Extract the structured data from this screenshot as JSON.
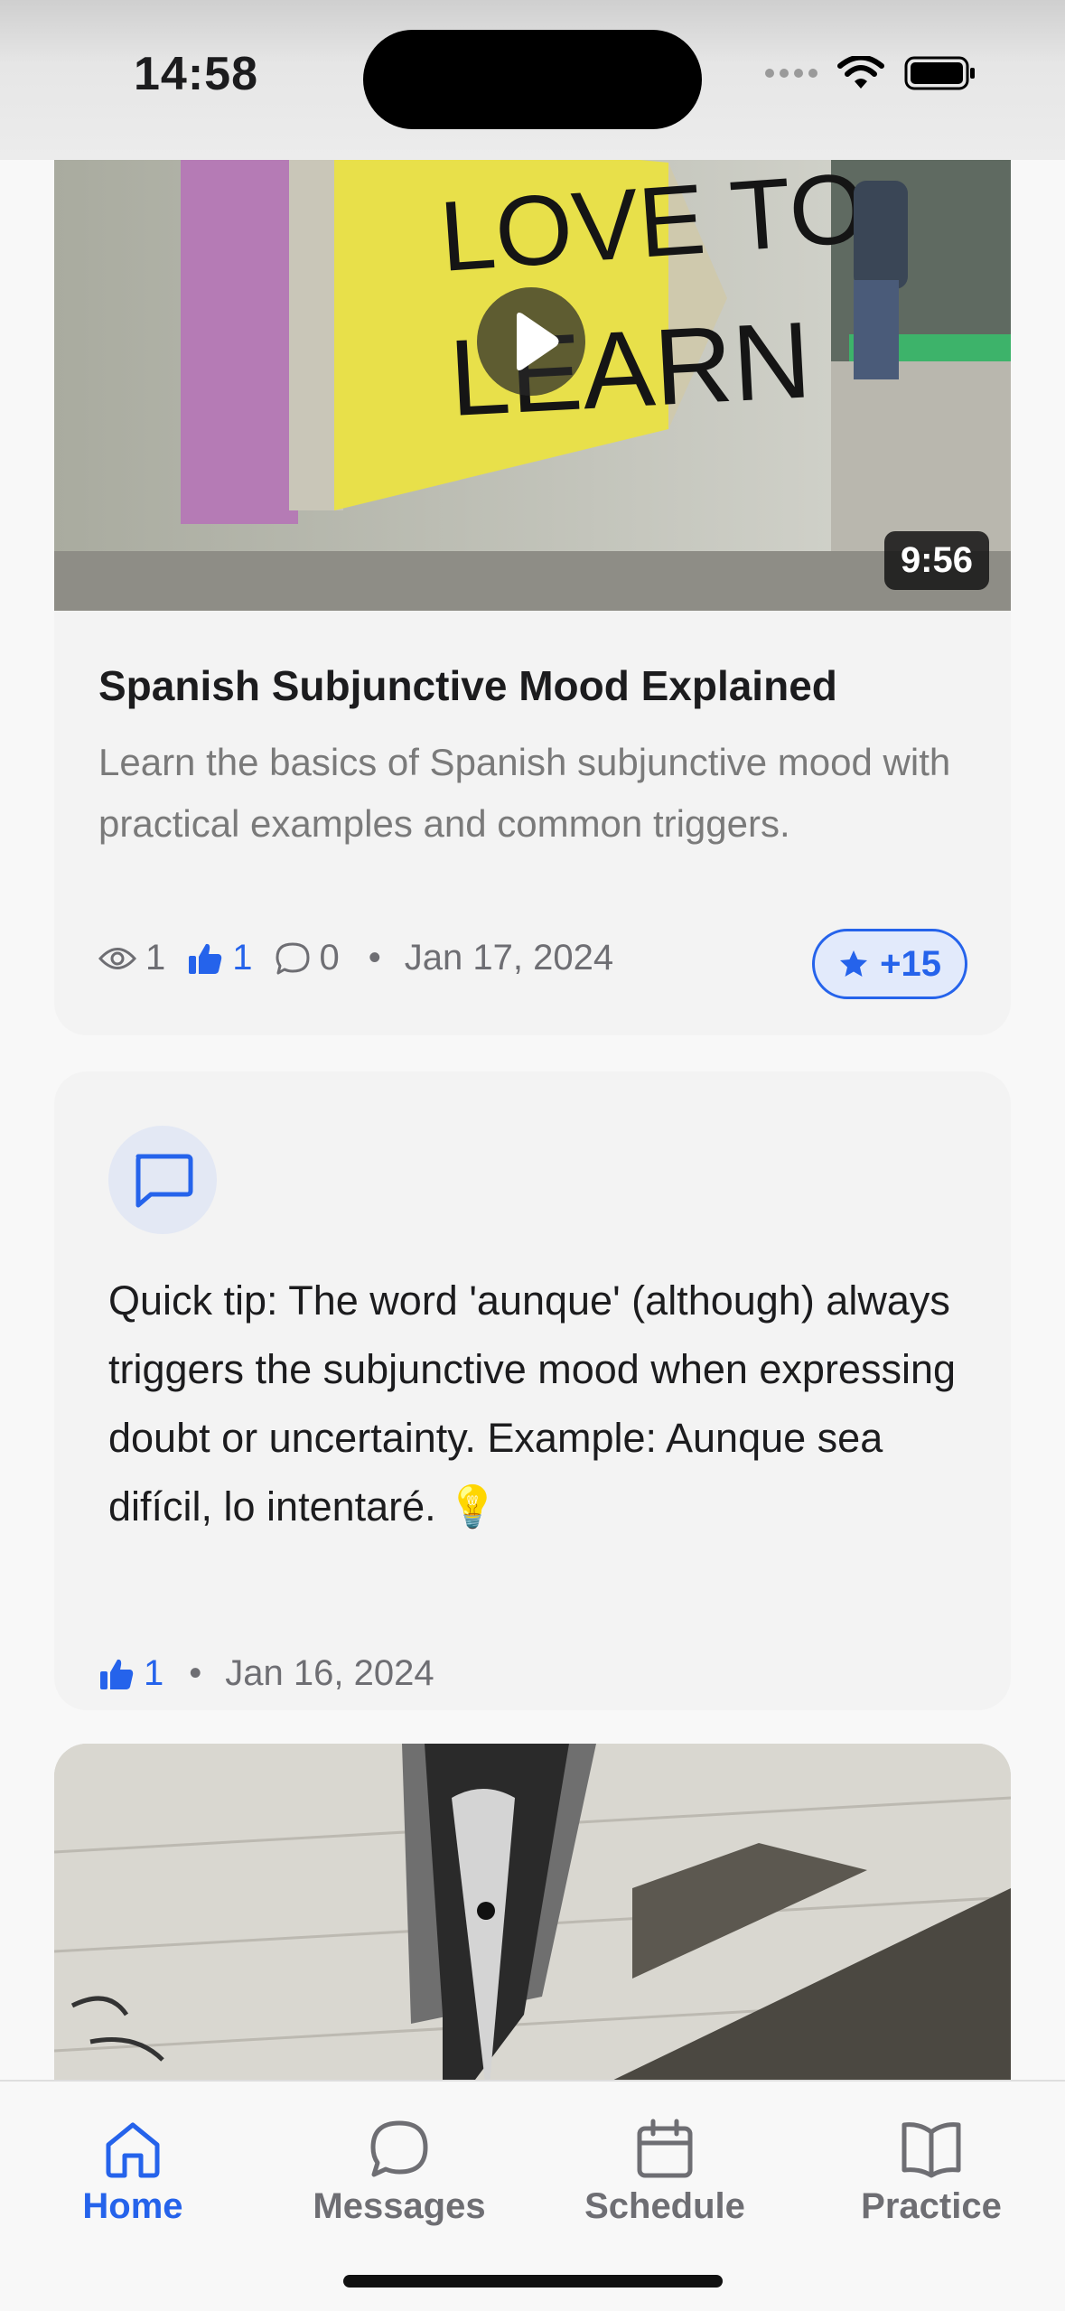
{
  "status_bar": {
    "time": "14:58"
  },
  "video_card": {
    "duration": "9:56",
    "title": "Spanish Subjunctive Mood Explained",
    "description": "Learn the basics of Spanish subjunctive mood with practical examples and common triggers.",
    "views": "1",
    "likes": "1",
    "comments": "0",
    "separator": "•",
    "date": "Jan 17, 2024",
    "points": "+15",
    "thumbnail_sign_text": [
      "LOVE TO",
      "LEARN"
    ]
  },
  "tip_card": {
    "text": "Quick tip: The word 'aunque' (although) always triggers the subjunctive mood when expressing doubt or uncertainty. Example: Aunque sea difícil, lo intentaré.",
    "emoji": "💡",
    "likes": "1",
    "separator": "•",
    "date": "Jan 16, 2024"
  },
  "tab_bar": {
    "tabs": [
      {
        "label": "Home",
        "icon": "home-icon",
        "active": true
      },
      {
        "label": "Messages",
        "icon": "chat-bubble-icon",
        "active": false
      },
      {
        "label": "Schedule",
        "icon": "calendar-icon",
        "active": false
      },
      {
        "label": "Practice",
        "icon": "book-icon",
        "active": false
      }
    ]
  },
  "colors": {
    "accent": "#2563eb",
    "card_bg": "#f3f3f3",
    "muted": "#6e6e73"
  }
}
